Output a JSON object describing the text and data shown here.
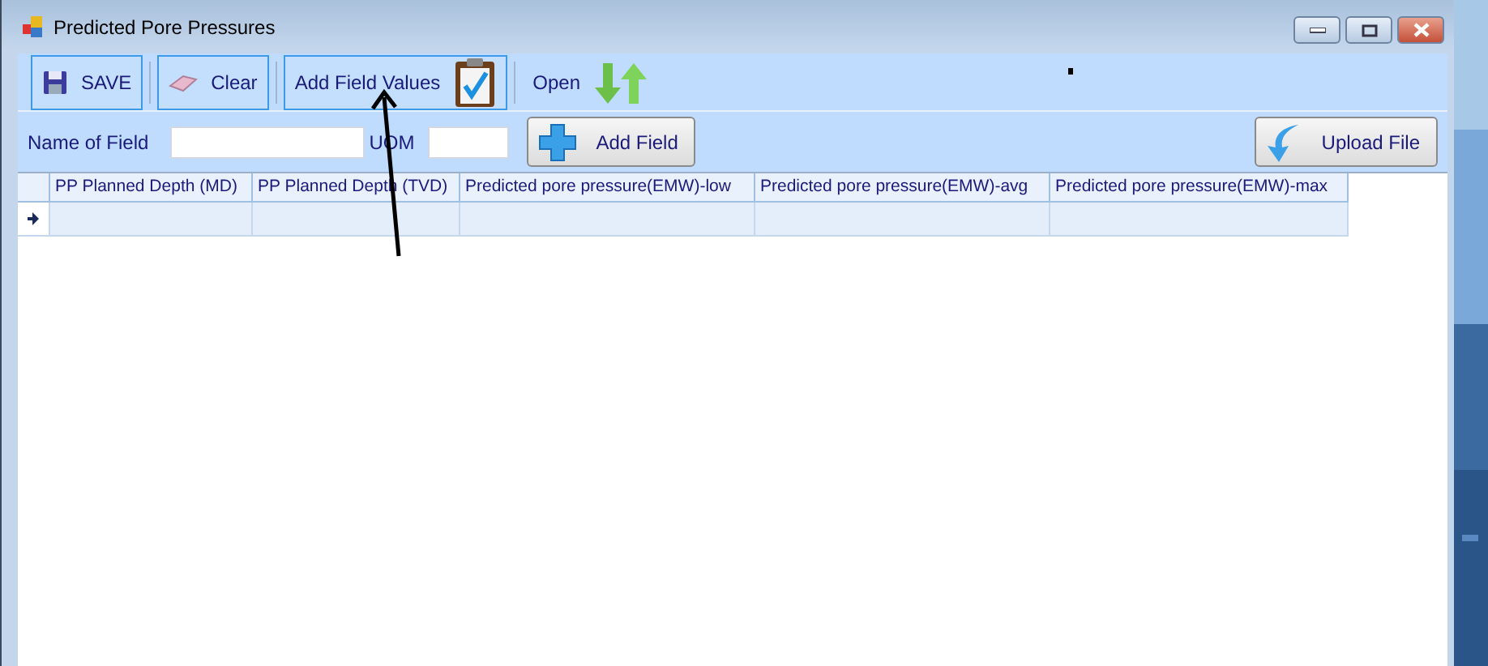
{
  "window": {
    "title": "Predicted Pore Pressures"
  },
  "toolbar": [
    {
      "kind": "button",
      "label": "SAVE"
    },
    {
      "kind": "button",
      "label": "Clear"
    },
    {
      "kind": "button",
      "label": "Add Field Values"
    },
    {
      "kind": "plain",
      "label": "Open"
    }
  ],
  "field_row": {
    "name_label": "Name of Field",
    "uom_label": "UOM",
    "add_button": "Add Field",
    "upload_button": "Upload File"
  },
  "table": {
    "columns": [
      "PP Planned Depth (MD)",
      "PP Planned Depth (TVD)",
      "Predicted pore pressure(EMW)-low",
      "Predicted pore pressure(EMW)-avg",
      "Predicted pore pressure(EMW)-max"
    ],
    "rows": [
      {
        "current": true
      }
    ]
  }
}
